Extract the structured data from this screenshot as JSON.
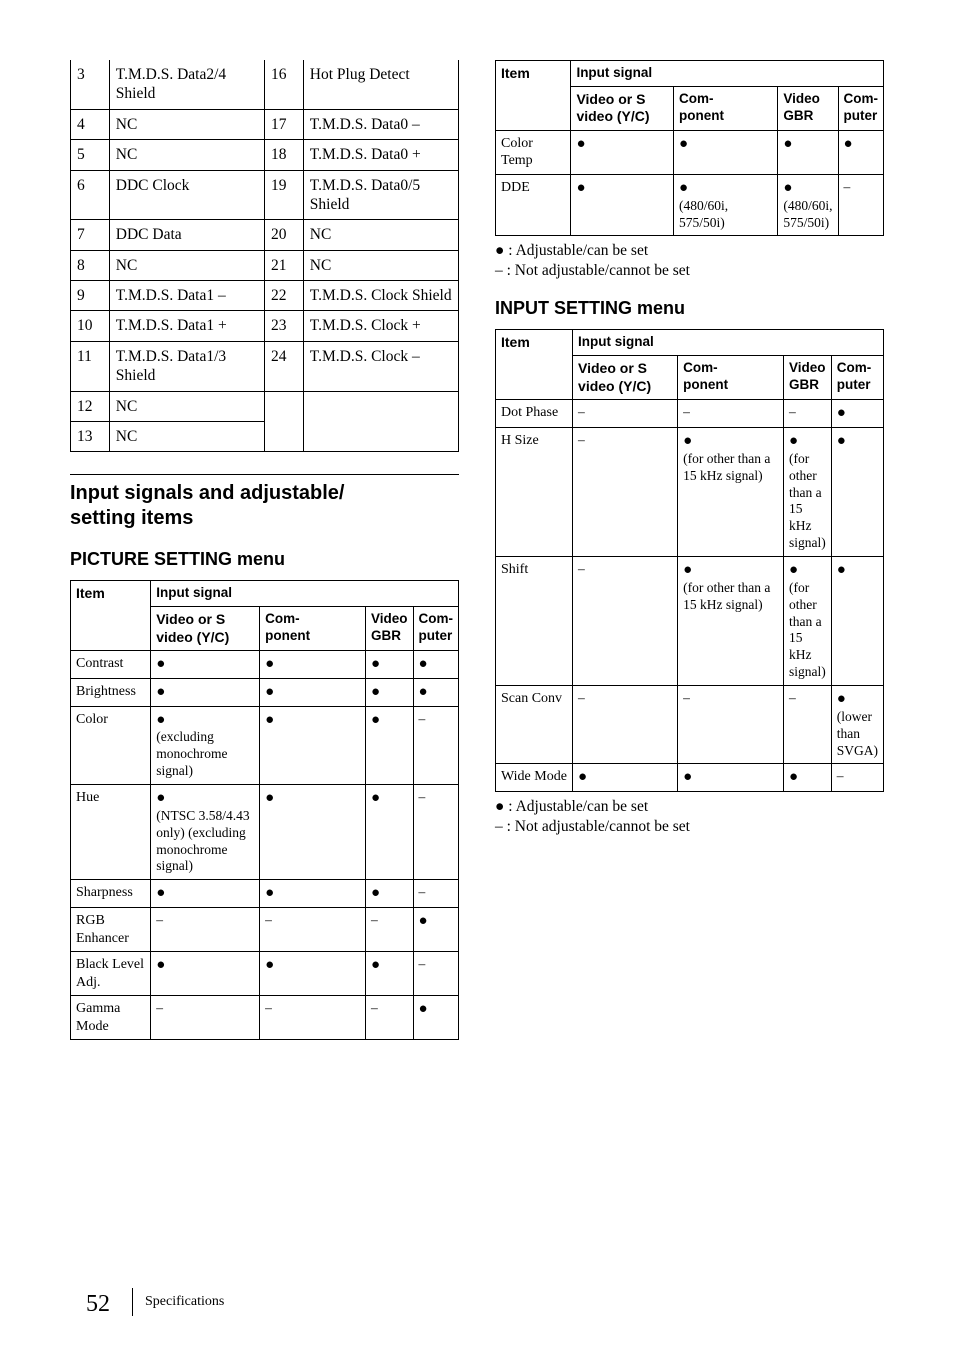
{
  "page": {
    "number": "52",
    "label": "Specifications"
  },
  "pins": {
    "rows": [
      {
        "a": "3",
        "b": "T.M.D.S. Data2/4 Shield",
        "c": "16",
        "d": "Hot Plug Detect"
      },
      {
        "a": "4",
        "b": "NC",
        "c": "17",
        "d": "T.M.D.S. Data0 –"
      },
      {
        "a": "5",
        "b": "NC",
        "c": "18",
        "d": "T.M.D.S. Data0 +"
      },
      {
        "a": "6",
        "b": "DDC Clock",
        "c": "19",
        "d": "T.M.D.S. Data0/5 Shield"
      },
      {
        "a": "7",
        "b": "DDC Data",
        "c": "20",
        "d": "NC"
      },
      {
        "a": "8",
        "b": "NC",
        "c": "21",
        "d": "NC"
      },
      {
        "a": "9",
        "b": "T.M.D.S. Data1 –",
        "c": "22",
        "d": "T.M.D.S. Clock Shield"
      },
      {
        "a": "10",
        "b": "T.M.D.S. Data1 +",
        "c": "23",
        "d": "T.M.D.S. Clock +"
      },
      {
        "a": "11",
        "b": "T.M.D.S. Data1/3 Shield",
        "c": "24",
        "d": "T.M.D.S. Clock –"
      },
      {
        "a": "12",
        "b": "NC",
        "c": "",
        "d": ""
      },
      {
        "a": "13",
        "b": "NC",
        "c": "",
        "d": ""
      }
    ]
  },
  "section1": {
    "title_line1": "Input signals and adjustable/",
    "title_line2": "setting items",
    "subtitle": "PICTURE SETTING menu"
  },
  "picture": {
    "head": {
      "item": "Item",
      "input": "Input signal",
      "c1": "Video or S video (Y/C)",
      "c2": "Com-\nponent",
      "c3": "Video GBR",
      "c4": "Com-\nputer"
    },
    "rows": [
      {
        "item": "Contrast",
        "c1": "●",
        "c2": "●",
        "c3": "●",
        "c4": "●"
      },
      {
        "item": "Brightness",
        "c1": "●",
        "c2": "●",
        "c3": "●",
        "c4": "●"
      },
      {
        "item": "Color",
        "c1": "● (excluding monochrome signal)",
        "c2": "●",
        "c3": "●",
        "c4": "–"
      },
      {
        "item": "Hue",
        "c1": "● (NTSC 3.58/4.43 only) (excluding monochrome signal)",
        "c2": "●",
        "c3": "●",
        "c4": "–"
      },
      {
        "item": "Sharpness",
        "c1": "●",
        "c2": "●",
        "c3": "●",
        "c4": "–"
      },
      {
        "item": "RGB Enhancer",
        "c1": "–",
        "c2": "–",
        "c3": "–",
        "c4": "●"
      },
      {
        "item": "Black Level Adj.",
        "c1": "●",
        "c2": "●",
        "c3": "●",
        "c4": "–"
      },
      {
        "item": "Gamma Mode",
        "c1": "–",
        "c2": "–",
        "c3": "–",
        "c4": "●"
      }
    ]
  },
  "picture_cont": {
    "head": {
      "item": "Item",
      "input": "Input signal",
      "c1": "Video or S video (Y/C)",
      "c2": "Com-\nponent",
      "c3": "Video GBR",
      "c4": "Com-\nputer"
    },
    "rows": [
      {
        "item": "Color Temp",
        "c1": "●",
        "c2": "●",
        "c3": "●",
        "c4": "●"
      },
      {
        "item": "DDE",
        "c1": "●",
        "c2": "● (480/60i, 575/50i)",
        "c3": "● (480/60i, 575/50i)",
        "c4": "–"
      }
    ],
    "legend1": "● : Adjustable/can be set",
    "legend2": "– : Not adjustable/cannot be set"
  },
  "section2": {
    "title": "INPUT SETTING menu"
  },
  "input_setting": {
    "head": {
      "item": "Item",
      "input": "Input signal",
      "c1": "Video or S video (Y/C)",
      "c2": "Com-\nponent",
      "c3": "Video GBR",
      "c4": "Com-\nputer"
    },
    "rows": [
      {
        "item": "Dot Phase",
        "c1": "–",
        "c2": "–",
        "c3": "–",
        "c4": "●"
      },
      {
        "item": "H Size",
        "c1": "–",
        "c2": "●(for other than a 15 kHz signal)",
        "c3": "●(for other than a 15 kHz signal)",
        "c4": "●"
      },
      {
        "item": "Shift",
        "c1": "–",
        "c2": "●(for other than a 15 kHz signal)",
        "c3": "●(for other than a 15 kHz signal)",
        "c4": "●"
      },
      {
        "item": "Scan Conv",
        "c1": "–",
        "c2": "–",
        "c3": "–",
        "c4": "● (lower than SVGA)"
      },
      {
        "item": "Wide Mode",
        "c1": "●",
        "c2": "●",
        "c3": "●",
        "c4": "–"
      }
    ],
    "legend1": "● : Adjustable/can be set",
    "legend2": "– : Not adjustable/cannot be set"
  }
}
